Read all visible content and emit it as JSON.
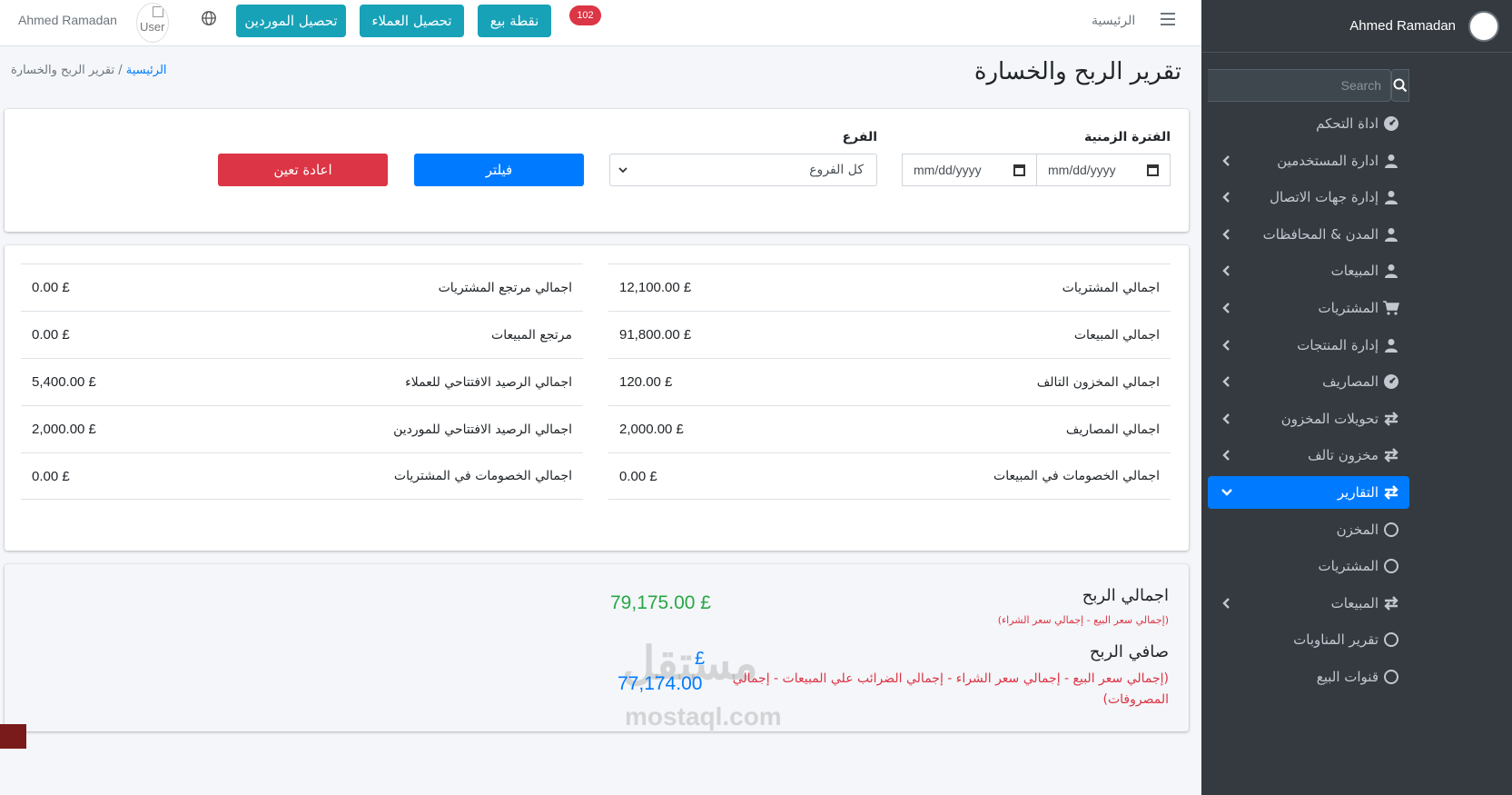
{
  "sidebar": {
    "user_name": "Ahmed Ramadan",
    "search_placeholder": "Search",
    "items": [
      {
        "label": "اداة التحكم",
        "icon": "dashboard-icon",
        "has_arrow": false
      },
      {
        "label": "ادارة المستخدمين",
        "icon": "user-icon",
        "has_arrow": true
      },
      {
        "label": "إدارة جهات الاتصال",
        "icon": "user-icon",
        "has_arrow": true
      },
      {
        "label": "المدن & المحافظات",
        "icon": "user-icon",
        "has_arrow": true
      },
      {
        "label": "المبيعات",
        "icon": "user-icon",
        "has_arrow": true
      },
      {
        "label": "المشتريات",
        "icon": "cart-icon",
        "has_arrow": true
      },
      {
        "label": "إدارة المنتجات",
        "icon": "user-icon",
        "has_arrow": true
      },
      {
        "label": "المصاريف",
        "icon": "dashboard-icon",
        "has_arrow": true
      },
      {
        "label": "تحويلات المخزون",
        "icon": "exchange-icon",
        "has_arrow": true
      },
      {
        "label": "مخزون تالف",
        "icon": "exchange-icon",
        "has_arrow": true
      },
      {
        "label": "التقارير",
        "icon": "exchange-icon",
        "has_arrow": true,
        "active": true
      },
      {
        "label": "المخزن",
        "icon": "circle-icon",
        "has_arrow": false
      },
      {
        "label": "المشتريات",
        "icon": "circle-icon",
        "has_arrow": false
      },
      {
        "label": "المبيعات",
        "icon": "exchange-icon",
        "has_arrow": true
      },
      {
        "label": "تقرير المناوبات",
        "icon": "circle-icon",
        "has_arrow": false
      },
      {
        "label": "قنوات البيع",
        "icon": "circle-icon",
        "has_arrow": false
      }
    ]
  },
  "navbar": {
    "user_name": "Ahmed Ramadan",
    "user_img_alt": "User",
    "btn_suppliers": "تحصيل الموردين",
    "btn_customers": "تحصيل العملاء",
    "btn_pos": "نقطة بيع",
    "badge_count": "102",
    "home": "الرئيسية"
  },
  "header": {
    "title": "تقرير الربح والخسارة",
    "breadcrumb_home": "الرئيسية",
    "breadcrumb_sep": " / ",
    "breadcrumb_current": "تقرير الربح والخسارة"
  },
  "filter": {
    "period_label": "الفترة الزمنية",
    "date_from": "mm/dd/yyyy",
    "date_to": "mm/dd/yyyy",
    "branch_label": "الفرع",
    "branch_value": "كل الفروع",
    "filter_btn": "فيلتر",
    "reset_btn": "اعادة تعين"
  },
  "totals": {
    "right": [
      {
        "label": "اجمالي المشتريات",
        "value": "12,100.00 £"
      },
      {
        "label": "اجمالي المبيعات",
        "value": "91,800.00 £"
      },
      {
        "label": "اجمالي المخزون التالف",
        "value": "120.00 £"
      },
      {
        "label": "اجمالي المصاريف",
        "value": "2,000.00 £"
      },
      {
        "label": "اجمالي الخصومات في المبيعات",
        "value": "0.00 £"
      }
    ],
    "left": [
      {
        "label": "اجمالي مرتجع المشتريات",
        "value": "0.00 £"
      },
      {
        "label": "مرتجع المبيعات",
        "value": "0.00 £"
      },
      {
        "label": "اجمالي الرصيد الافتتاحي للعملاء",
        "value": "5,400.00 £"
      },
      {
        "label": "اجمالي الرصيد الافتتاحي للموردين",
        "value": "2,000.00 £"
      },
      {
        "label": "اجمالي الخصومات في المشتريات",
        "value": "0.00 £"
      }
    ]
  },
  "profit": {
    "gross_title": "اجمالي الربح",
    "gross_formula": "(إجمالي سعر البيع - إجمالي سعر الشراء)",
    "gross_value": "79,175.00 £",
    "net_title": "صافي الربح",
    "net_formula_line1": "(إجمالي سعر البيع - إجمالي سعر الشراء - إجمالي الضرائب علي المبيعات - إجمالي",
    "net_formula_line2": "المصروفات)",
    "net_currency": "£",
    "net_value": "77,174.00"
  },
  "watermark": {
    "arabic": "مستقل",
    "latin": "mostaql.com"
  },
  "colors": {
    "sidebar_bg": "#343a40",
    "primary": "#007bff",
    "info": "#17a2b8",
    "danger": "#dc3545",
    "success": "#28a745"
  }
}
